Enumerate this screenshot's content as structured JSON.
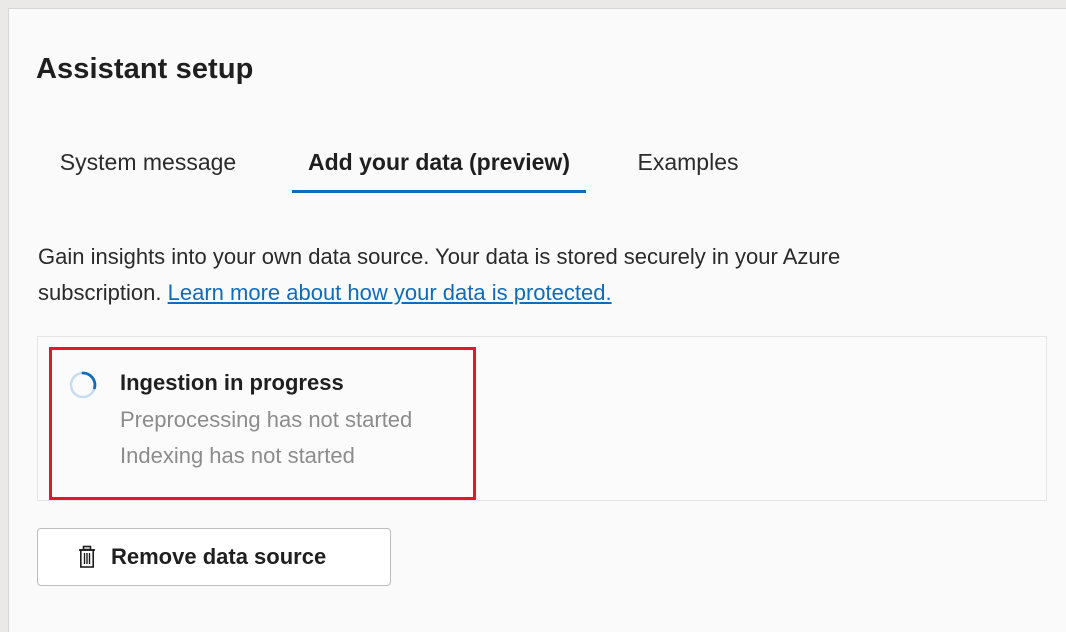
{
  "page": {
    "title": "Assistant setup"
  },
  "tabs": [
    {
      "label": "System message",
      "active": false
    },
    {
      "label": "Add your data (preview)",
      "active": true
    },
    {
      "label": "Examples",
      "active": false
    }
  ],
  "description": {
    "line1": "Gain insights into your own data source. Your data is stored securely in your Azure",
    "line2_prefix": "subscription. ",
    "link": "Learn more about how your data is protected."
  },
  "status": {
    "title": "Ingestion in progress",
    "preprocessing": "Preprocessing has not started",
    "indexing": "Indexing has not started"
  },
  "actions": {
    "remove_label": "Remove data source"
  },
  "icons": {
    "spinner": "loading-spinner-icon",
    "trash": "trash-icon"
  },
  "colors": {
    "accent": "#0f6cbd",
    "highlight_border": "#e01b24",
    "muted_text": "#8c8c8c"
  }
}
